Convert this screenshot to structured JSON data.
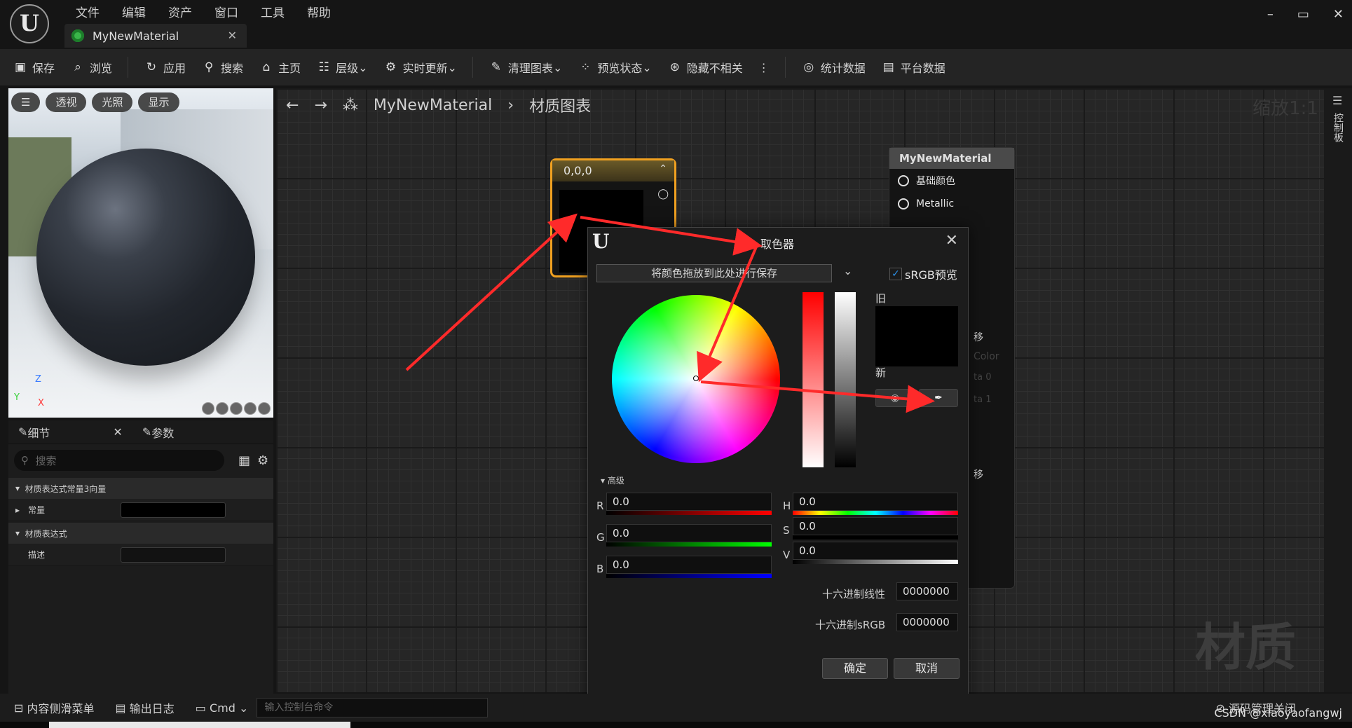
{
  "app": {
    "menu": [
      "文件",
      "编辑",
      "资产",
      "窗口",
      "工具",
      "帮助"
    ],
    "tab_title": "MyNewMaterial",
    "window_controls": [
      "–",
      "▭",
      "✕"
    ]
  },
  "toolbar": {
    "save": "保存",
    "browse": "浏览",
    "apply": "应用",
    "search": "搜索",
    "home": "主页",
    "hierarchy": "层级",
    "live_update": "实时更新",
    "clean_graph": "清理图表",
    "preview_state": "预览状态",
    "hide_unrelated": "隐藏不相关",
    "stats": "统计数据",
    "platform_stats": "平台数据"
  },
  "viewport": {
    "buttons": [
      "透视",
      "光照",
      "显示"
    ],
    "axis": {
      "z": "Z",
      "y": "Y",
      "x": "X"
    }
  },
  "details": {
    "tab1": "细节",
    "tab2": "参数",
    "search_placeholder": "搜索",
    "category1": "材质表达式常量3向量",
    "row1": "常量",
    "category2": "材质表达式",
    "row2": "描述"
  },
  "graph": {
    "breadcrumb_root": "MyNewMaterial",
    "breadcrumb_leaf": "材质图表",
    "zoom": "缩放1:1",
    "watermark": "材质",
    "right_panel_label": "控制板",
    "const_node_title": "0,0,0",
    "material_node_title": "MyNewMaterial",
    "pins": [
      "基础颜色",
      "Metallic"
    ],
    "partial_texts": [
      "移",
      "Color",
      "ta 0",
      "ta 1",
      "移"
    ]
  },
  "color_picker": {
    "title": "取色器",
    "drop_hint": "将颜色拖放到此处进行保存",
    "srgb_preview": "sRGB预览",
    "old": "旧",
    "new": "新",
    "advanced": "高级",
    "r_label": "R",
    "r_value": "0.0",
    "g_label": "G",
    "g_value": "0.0",
    "b_label": "B",
    "b_value": "0.0",
    "h_label": "H",
    "h_value": "0.0",
    "s_label": "S",
    "s_value": "0.0",
    "v_label": "V",
    "v_value": "0.0",
    "hex_linear_label": "十六进制线性",
    "hex_linear": "0000000",
    "hex_srgb_label": "十六进制sRGB",
    "hex_srgb": "0000000",
    "ok": "确定",
    "cancel": "取消"
  },
  "statusbar": {
    "content_drawer": "内容侧滑菜单",
    "output_log": "输出日志",
    "cmd": "Cmd",
    "console_placeholder": "输入控制台命令",
    "source_control": "源码管理关闭"
  },
  "credit": "CSDN @xiaoyaofangwj",
  "colors": {
    "accent_node": "#f0a020",
    "arrow": "#ff2a2a",
    "checkbox": "#2b8fe6"
  }
}
